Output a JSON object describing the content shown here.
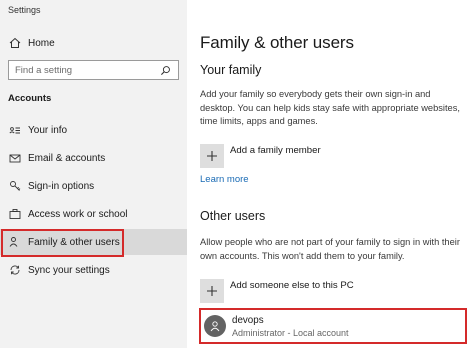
{
  "window": {
    "title": "Settings"
  },
  "sidebar": {
    "home_label": "Home",
    "search": {
      "placeholder": "Find a setting",
      "value": ""
    },
    "section_label": "Accounts",
    "items": [
      {
        "label": "Your info",
        "icon": "person-card-icon"
      },
      {
        "label": "Email & accounts",
        "icon": "mail-icon"
      },
      {
        "label": "Sign-in options",
        "icon": "key-icon"
      },
      {
        "label": "Access work or school",
        "icon": "briefcase-icon"
      },
      {
        "label": "Family & other users",
        "icon": "people-icon",
        "selected": true
      },
      {
        "label": "Sync your settings",
        "icon": "sync-icon"
      }
    ]
  },
  "main": {
    "page_title": "Family & other users",
    "family": {
      "heading": "Your family",
      "description": "Add your family so everybody gets their own sign-in and desktop. You can help kids stay safe with appropriate websites, time limits, apps and games.",
      "add_label": "Add a family member",
      "learn_more": "Learn more"
    },
    "others": {
      "heading": "Other users",
      "description": "Allow people who are not part of your family to sign in with their own accounts. This won't add them to your family.",
      "add_label": "Add someone else to this PC",
      "users": [
        {
          "name": "devops",
          "role": "Administrator - Local account"
        }
      ]
    }
  },
  "colors": {
    "sidebar_bg": "#f2f2f2",
    "selected_bg": "#d9d9d9",
    "link": "#1a6bb5",
    "highlight_border": "#d42a2a",
    "avatar_bg": "#636363"
  }
}
